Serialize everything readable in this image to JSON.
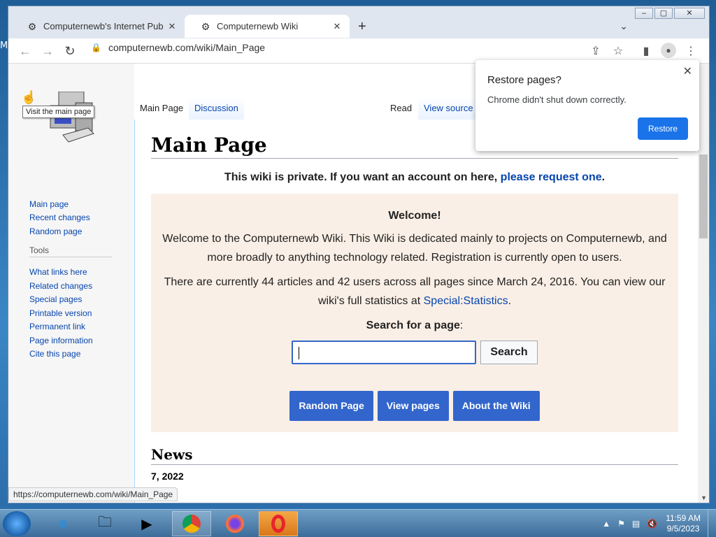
{
  "desktop": {
    "stray_letter": "M"
  },
  "browser": {
    "tabs": [
      {
        "title": "Computernewb's Internet Pub Hu",
        "active": false
      },
      {
        "title": "Computernewb Wiki",
        "active": true
      }
    ],
    "new_tab": "+",
    "address": "computernewb.com/wiki/Main_Page",
    "status_url": "https://computernewb.com/wiki/Main_Page"
  },
  "popup": {
    "title": "Restore pages?",
    "message": "Chrome didn't shut down correctly.",
    "button": "Restore"
  },
  "sidebar": {
    "tooltip": "Visit the main page",
    "nav": [
      "Main page",
      "Recent changes",
      "Random page"
    ],
    "tools_heading": "Tools",
    "tools": [
      "What links here",
      "Related changes",
      "Special pages",
      "Printable version",
      "Permanent link",
      "Page information",
      "Cite this page"
    ]
  },
  "page_tabs": {
    "main_page": "Main Page",
    "discussion": "Discussion",
    "read": "Read",
    "view_source": "View source"
  },
  "content": {
    "title": "Main Page",
    "notice_text": "This wiki is private. If you want an account on here, ",
    "notice_link": "please request one",
    "notice_end": ".",
    "welcome_heading": "Welcome!",
    "welcome_p1": "Welcome to the Computernewb Wiki. This Wiki is dedicated mainly to projects on Computernewb, and more broadly to anything technology related. Registration is currently open to users.",
    "welcome_p2": "There are currently 44 articles and 42 users across all pages since March 24, 2016. You can view our wiki's full statistics at ",
    "stats_link": "Special:Statistics",
    "stats_end": ".",
    "search_label": "Search for a page",
    "search_colon": ":",
    "search_button": "Search",
    "buttons": [
      "Random Page",
      "View pages",
      "About the Wiki"
    ],
    "news_heading": "News",
    "news_date": "7, 2022"
  },
  "taskbar": {
    "time": "11:59 AM",
    "date": "9/5/2023"
  }
}
